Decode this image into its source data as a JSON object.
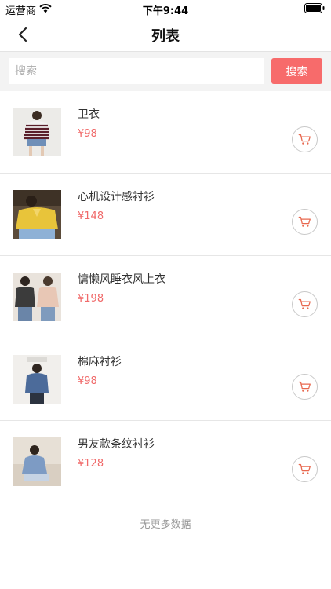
{
  "status_bar": {
    "carrier": "运营商",
    "time": "下午9:44",
    "wifi_icon": "wifi-icon",
    "battery_icon": "battery-icon"
  },
  "nav": {
    "title": "列表",
    "back_icon": "chevron-left-icon"
  },
  "search": {
    "placeholder": "搜索",
    "button_label": "搜索"
  },
  "products": [
    {
      "name": "卫衣",
      "price": "¥98"
    },
    {
      "name": "心机设计感衬衫",
      "price": "¥148"
    },
    {
      "name": "慵懒风睡衣风上衣",
      "price": "¥198"
    },
    {
      "name": "棉麻衬衫",
      "price": "¥98"
    },
    {
      "name": "男友款条纹衬衫",
      "price": "¥128"
    }
  ],
  "cart_icon": "shopping-cart-icon",
  "footer": "无更多数据",
  "colors": {
    "accent": "#f76b6b",
    "price": "#f06a6a"
  }
}
